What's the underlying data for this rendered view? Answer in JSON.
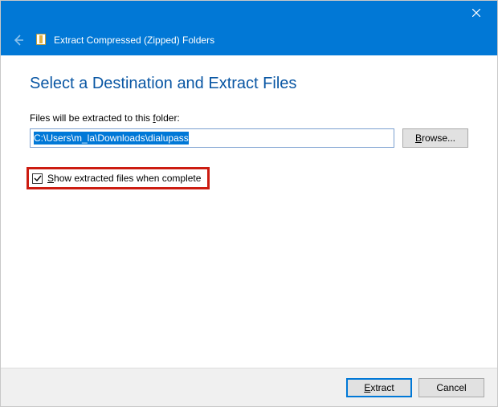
{
  "window": {
    "title": "Extract Compressed (Zipped) Folders"
  },
  "heading": "Select a Destination and Extract Files",
  "field": {
    "label_pre": "Files will be extracted to this ",
    "label_u": "f",
    "label_post": "older:",
    "value": "C:\\Users\\m_la\\Downloads\\dialupass"
  },
  "browse": {
    "label_u": "B",
    "label_post": "rowse..."
  },
  "checkbox": {
    "checked": true,
    "label_u": "S",
    "label_post": "how extracted files when complete"
  },
  "buttons": {
    "extract_u": "E",
    "extract_post": "xtract",
    "cancel": "Cancel"
  }
}
